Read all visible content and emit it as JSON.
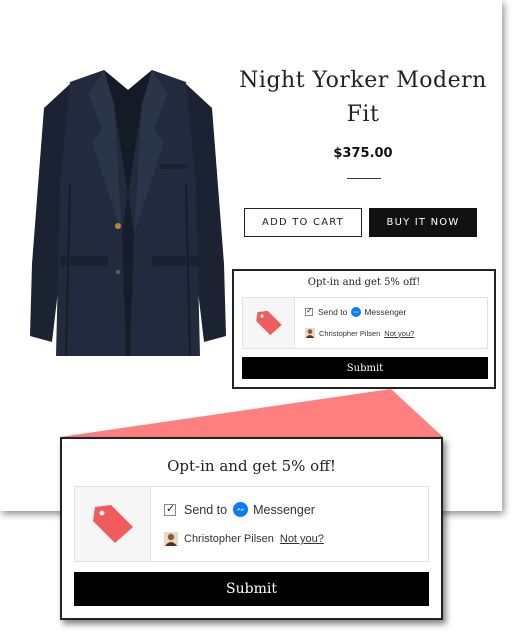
{
  "product": {
    "title_line1": "Night Yorker Modern",
    "title_line2": "Fit",
    "price": "$375.00",
    "add_to_cart_label": "ADD TO CART",
    "buy_now_label": "BUY IT NOW"
  },
  "optin_widget": {
    "heading": "Opt-in and get 5% off!",
    "send_to_label": "Send to",
    "messenger_label": "Messenger",
    "user_name": "Christopher Pilsen",
    "not_you_label": "Not you?",
    "submit_label": "Submit",
    "checkbox_checked": true,
    "icons": [
      "tag-icon",
      "messenger-icon",
      "avatar"
    ]
  },
  "colors": {
    "tag": "#f05b5b",
    "callout": "#ff7f7f",
    "messenger": "#0a7cff",
    "submit_bg": "#000000"
  }
}
